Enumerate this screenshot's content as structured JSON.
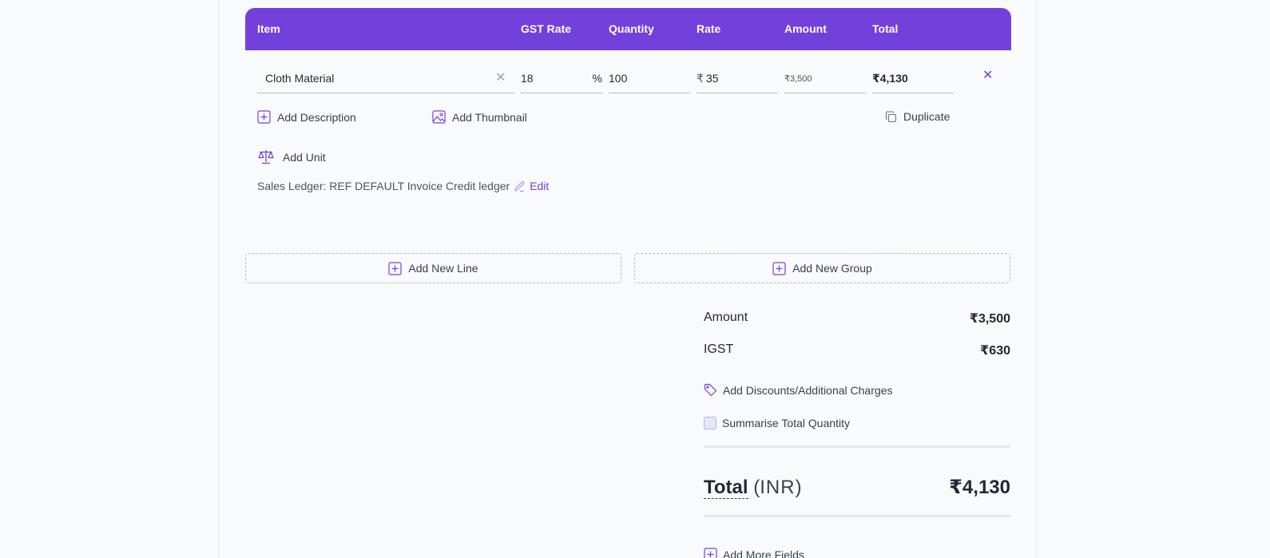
{
  "colors": {
    "accent": "#7440dc",
    "text": "#1f2937",
    "muted": "#6b7280"
  },
  "table": {
    "headers": {
      "item": "Item",
      "gst_rate": "GST Rate",
      "quantity": "Quantity",
      "rate": "Rate",
      "amount": "Amount",
      "total": "Total"
    }
  },
  "line_item": {
    "item": "Cloth Material",
    "gst_rate": "18",
    "gst_unit": "%",
    "quantity": "100",
    "rate_currency": "₹",
    "rate": "35",
    "amount": "₹3,500",
    "total": "₹4,130",
    "actions": {
      "add_description": "Add Description",
      "add_thumbnail": "Add Thumbnail",
      "duplicate": "Duplicate",
      "add_unit": "Add Unit"
    },
    "sales_ledger": "Sales Ledger: REF DEFAULT Invoice Credit ledger",
    "edit": "Edit"
  },
  "buttons": {
    "add_new_line": "Add New Line",
    "add_new_group": "Add New Group"
  },
  "summary": {
    "amount_label": "Amount",
    "amount_value": "₹3,500",
    "igst_label": "IGST",
    "igst_value": "₹630",
    "discounts": "Add Discounts/Additional Charges",
    "summarise": "Summarise Total Quantity",
    "total_label": "Total",
    "currency": "INR",
    "total_value": "₹4,130",
    "add_more_fields": "Add More Fields"
  }
}
